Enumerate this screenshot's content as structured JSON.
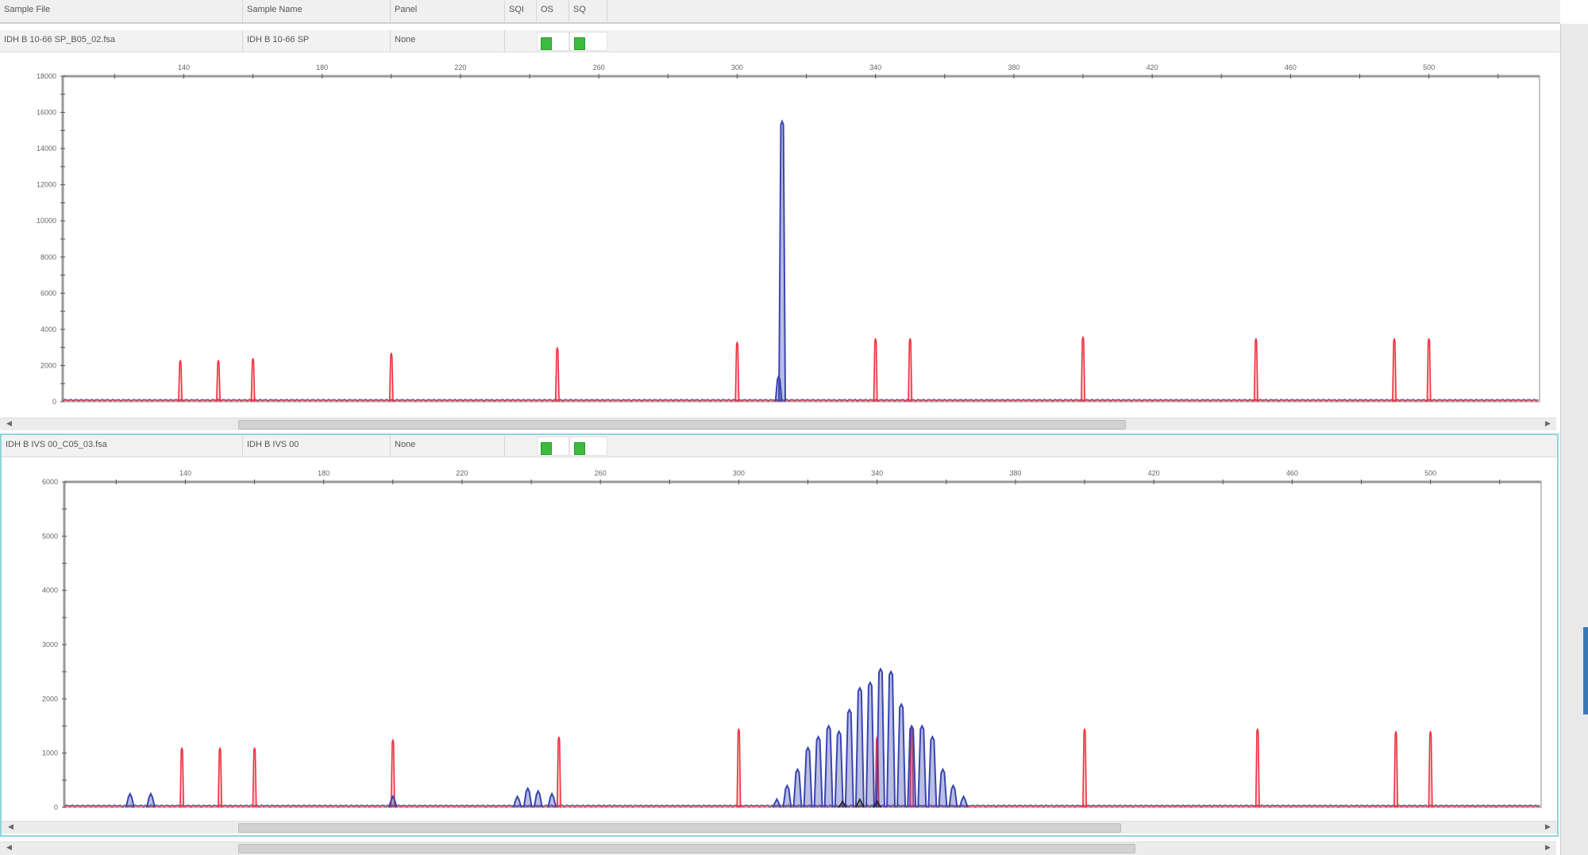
{
  "table": {
    "headers": [
      "Sample File",
      "Sample Name",
      "Panel",
      "SQI",
      "OS",
      "SQ"
    ],
    "rows": [
      {
        "file": "IDH B 10-66 SP_B05_02.fsa",
        "name": "IDH B 10-66 SP",
        "panel": "None"
      },
      {
        "file": "IDH B IVS 00_C05_03.fsa",
        "name": "IDH B IVS 00",
        "panel": "None"
      }
    ]
  },
  "colors": {
    "blue": "#3a45b0",
    "red": "#f03040",
    "green": "#30a030",
    "black": "#222222",
    "accent": "#8fd6dc",
    "status_ok": "#3cbc3c"
  },
  "chart_data": [
    {
      "type": "line",
      "title": "IDH B 10-66 SP",
      "xlim": [
        105,
        532
      ],
      "ylim": [
        0,
        18000
      ],
      "x_ticks": [
        140,
        180,
        220,
        260,
        300,
        340,
        380,
        420,
        460,
        500
      ],
      "y_ticks": [
        0,
        2000,
        4000,
        6000,
        8000,
        10000,
        12000,
        14000,
        16000,
        18000
      ],
      "series": [
        {
          "name": "size standard (red)",
          "color": "red",
          "peaks": [
            [
              139,
              2300
            ],
            [
              150,
              2300
            ],
            [
              160,
              2400
            ],
            [
              200,
              2700
            ],
            [
              248,
              3000
            ],
            [
              300,
              3300
            ],
            [
              340,
              3500
            ],
            [
              350,
              3500
            ],
            [
              400,
              3600
            ],
            [
              450,
              3500
            ],
            [
              490,
              3500
            ],
            [
              500,
              3500
            ]
          ]
        },
        {
          "name": "sample (blue)",
          "color": "blue",
          "peaks": [
            [
              312,
              1400
            ],
            [
              313,
              15500
            ]
          ]
        }
      ]
    },
    {
      "type": "line",
      "title": "IDH B IVS 00",
      "xlim": [
        105,
        532
      ],
      "ylim": [
        0,
        6000
      ],
      "x_ticks": [
        140,
        180,
        220,
        260,
        300,
        340,
        380,
        420,
        460,
        500
      ],
      "y_ticks": [
        0,
        1000,
        2000,
        3000,
        4000,
        5000,
        6000
      ],
      "series": [
        {
          "name": "size standard (red)",
          "color": "red",
          "peaks": [
            [
              139,
              1100
            ],
            [
              150,
              1100
            ],
            [
              160,
              1100
            ],
            [
              200,
              1250
            ],
            [
              248,
              1300
            ],
            [
              300,
              1450
            ],
            [
              340,
              1300
            ],
            [
              350,
              1500
            ],
            [
              400,
              1450
            ],
            [
              450,
              1450
            ],
            [
              490,
              1400
            ],
            [
              500,
              1400
            ]
          ]
        },
        {
          "name": "sample (blue)",
          "color": "blue",
          "peaks": [
            [
              124,
              250
            ],
            [
              130,
              250
            ],
            [
              200,
              200
            ],
            [
              236,
              200
            ],
            [
              239,
              350
            ],
            [
              242,
              300
            ],
            [
              246,
              250
            ],
            [
              311,
              150
            ],
            [
              314,
              400
            ],
            [
              317,
              700
            ],
            [
              320,
              1100
            ],
            [
              323,
              1300
            ],
            [
              326,
              1500
            ],
            [
              329,
              1400
            ],
            [
              332,
              1800
            ],
            [
              335,
              2200
            ],
            [
              338,
              2300
            ],
            [
              341,
              2550
            ],
            [
              344,
              2500
            ],
            [
              347,
              1900
            ],
            [
              350,
              1500
            ],
            [
              353,
              1500
            ],
            [
              356,
              1300
            ],
            [
              359,
              700
            ],
            [
              362,
              400
            ],
            [
              365,
              200
            ]
          ]
        },
        {
          "name": "black",
          "color": "black",
          "peaks": [
            [
              330,
              120
            ],
            [
              335,
              150
            ],
            [
              340,
              120
            ]
          ]
        }
      ]
    }
  ]
}
